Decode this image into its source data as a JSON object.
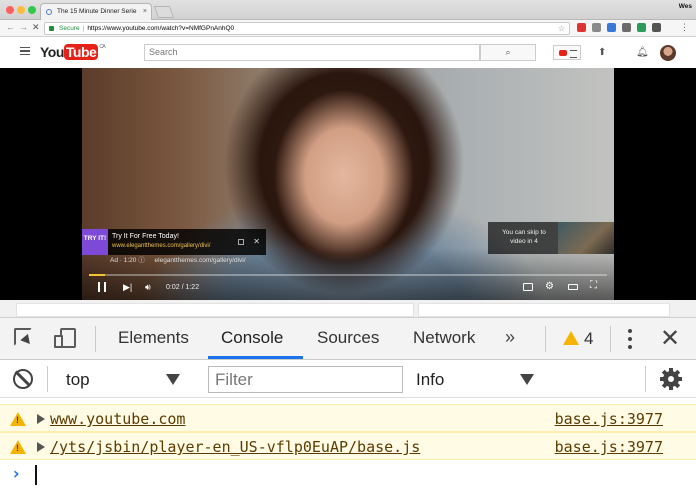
{
  "browser": {
    "tab_title": "The 15 Minute Dinner Serie",
    "tab_close": "×",
    "user_name": "Wes",
    "secure_label": "Secure",
    "url": "https://www.youtube.com/watch?v=NMfGPnAnhQ0"
  },
  "youtube": {
    "logo_you": "You",
    "logo_tube": "Tube",
    "logo_region": "CA",
    "search_placeholder": "Search"
  },
  "player": {
    "ad": {
      "logo_text": "TRY IT!",
      "title": "Try It For Free Today!",
      "url": "www.elegantthemes.com/gallery/divi/",
      "ad_label": "Ad · 1:20",
      "domain": "elegantthemes.com/gallery/divi/"
    },
    "skip_text": "You can skip to video in 4",
    "time": "0:02 / 1:22",
    "progress_fraction": 0.03
  },
  "devtools": {
    "tabs": [
      "Elements",
      "Console",
      "Sources",
      "Network"
    ],
    "active_tab": "Console",
    "more_tabs": "»",
    "warning_count": "4",
    "context": "top",
    "filter_placeholder": "Filter",
    "level": "Info",
    "messages": [
      {
        "text": "www.youtube.com",
        "source": "base.js:3977"
      },
      {
        "text": "/yts/jsbin/player-en_US-vflp0EuAP/base.js",
        "source": "base.js:3977"
      }
    ],
    "prompt": "›"
  }
}
